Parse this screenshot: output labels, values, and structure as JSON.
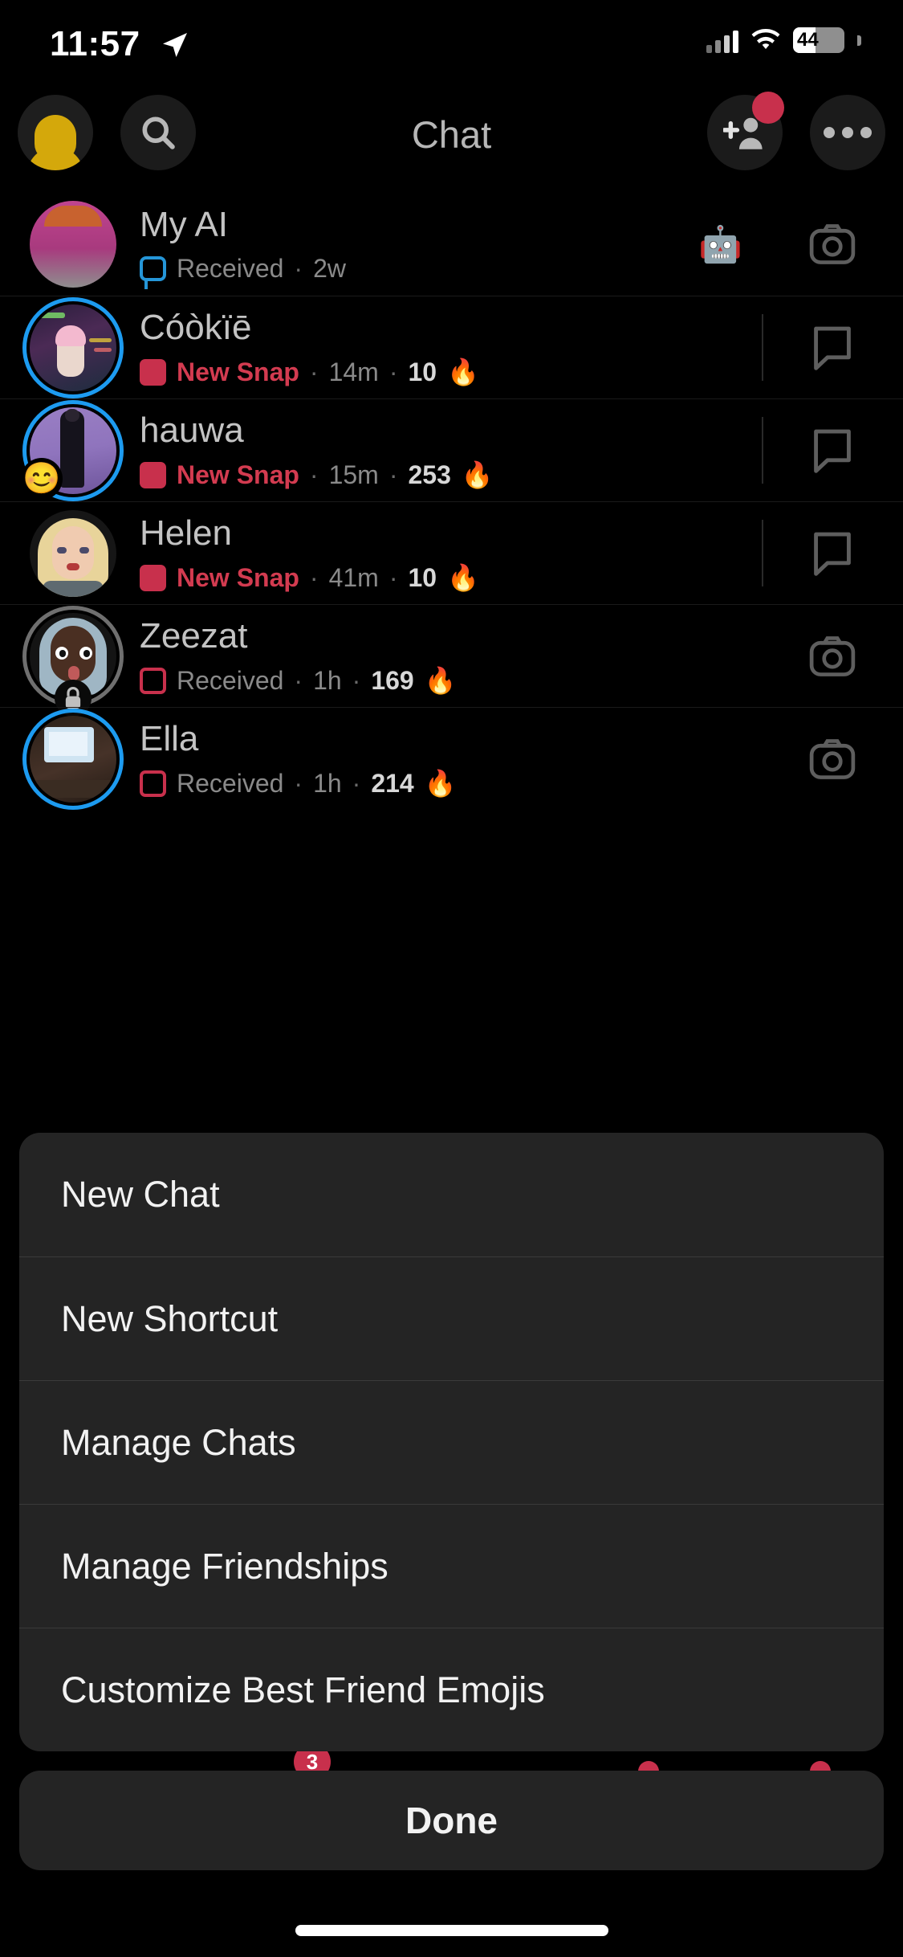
{
  "status_bar": {
    "time": "11:57",
    "battery_percent": "44",
    "location_icon": "location-arrow-icon",
    "cellular_icon": "cellular-bars-icon",
    "wifi_icon": "wifi-icon"
  },
  "header": {
    "title": "Chat",
    "profile_icon": "bitmoji-avatar-icon",
    "search_icon": "search-icon",
    "add_friend_icon": "add-friend-icon",
    "more_icon": "more-options-icon",
    "add_friend_has_badge": true,
    "accent_red": "#c8304c",
    "accent_blue": "#1d9bf0"
  },
  "chats": [
    {
      "name": "My AI",
      "status_icon": "chat-bubble-outline-blue",
      "status_label": "Received",
      "status_label_color": "gray",
      "time": "2w",
      "streak": "",
      "streak_emoji": "",
      "ring": "none",
      "badge_emoji": "🤖",
      "action_icon": "camera-icon",
      "avatar_kind": "bitmoji-pink"
    },
    {
      "name": "Cóòkïē",
      "status_icon": "snap-square-filled-red",
      "status_label": "New Snap",
      "status_label_color": "red",
      "time": "14m",
      "streak": "10",
      "streak_emoji": "🔥",
      "ring": "blue",
      "badge_emoji": "",
      "action_icon": "chat-bubble-icon",
      "avatar_kind": "photo-game"
    },
    {
      "name": "hauwa",
      "status_icon": "snap-square-filled-red",
      "status_label": "New Snap",
      "status_label_color": "red",
      "time": "15m",
      "streak": "253",
      "streak_emoji": "🔥",
      "ring": "blue",
      "badge_emoji": "😊",
      "action_icon": "chat-bubble-icon",
      "avatar_kind": "photo-purple"
    },
    {
      "name": "Helen",
      "status_icon": "snap-square-filled-red",
      "status_label": "New Snap",
      "status_label_color": "red",
      "time": "41m",
      "streak": "10",
      "streak_emoji": "🔥",
      "ring": "none",
      "badge_emoji": "",
      "action_icon": "chat-bubble-icon",
      "avatar_kind": "bitmoji-blonde"
    },
    {
      "name": "Zeezat",
      "status_icon": "snap-square-outline-red",
      "status_label": "Received",
      "status_label_color": "gray",
      "time": "1h",
      "streak": "169",
      "streak_emoji": "🔥",
      "ring": "gray",
      "badge_emoji": "",
      "badge_lock": true,
      "action_icon": "camera-icon",
      "avatar_kind": "bitmoji-dark"
    },
    {
      "name": "Ella",
      "status_icon": "snap-square-outline-red",
      "status_label": "Received",
      "status_label_color": "gray",
      "time": "1h",
      "streak": "214",
      "streak_emoji": "🔥",
      "ring": "blue",
      "badge_emoji": "",
      "action_icon": "camera-icon",
      "avatar_kind": "photo-room"
    }
  ],
  "action_sheet": {
    "items": [
      {
        "label": "New Chat"
      },
      {
        "label": "New Shortcut"
      },
      {
        "label": "Manage Chats"
      },
      {
        "label": "Manage Friendships"
      },
      {
        "label": "Customize Best Friend Emojis"
      }
    ],
    "done_label": "Done"
  },
  "tab_bar": {
    "badges": [
      "3",
      "",
      ""
    ]
  }
}
